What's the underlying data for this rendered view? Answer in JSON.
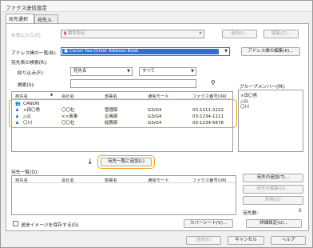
{
  "window": {
    "title": "ファクス送信設定"
  },
  "tabs": [
    {
      "label": "宛先選択",
      "active": true
    },
    {
      "label": "宛先入力",
      "active": false
    }
  ],
  "favorites": {
    "label": "お気に入り(F)",
    "value": "標準設定",
    "add_button": "追加(I)...",
    "edit_button": "編集(Z)..."
  },
  "address_book": {
    "label": "アドレス帳の一覧(B):",
    "value": "Canon Fax Driver Address Book",
    "edit_button": "アドレス帳の編集(K)..."
  },
  "search": {
    "section_label": "宛先表の検索(R):",
    "filter_label": "絞り込み(F):",
    "filter_value": "宛先名",
    "filter_scope": "すべて",
    "keyword_label": "検索(S):",
    "keyword_value": ""
  },
  "group_members": {
    "label": "グループメンバー(M):",
    "items": [
      "×田〇男",
      "△山",
      "〇川"
    ]
  },
  "columns": [
    "宛先名",
    "会社名",
    "部署名",
    "通信モード",
    "ファクス番号/URI"
  ],
  "address_rows": [
    {
      "type": "group",
      "name": "CANON",
      "company": "",
      "dept": "",
      "mode": "",
      "fax": ""
    },
    {
      "type": "person",
      "name": "×田〇男",
      "company": "〇〇社",
      "dept": "管理部",
      "mode": "G3/G4",
      "fax": "03-1111-2222"
    },
    {
      "type": "person",
      "name": "△山",
      "company": "××商事",
      "dept": "企画部",
      "mode": "G3/G4",
      "fax": "03-1234-1111"
    },
    {
      "type": "person",
      "name": "〇川",
      "company": "〇〇社",
      "dept": "総務部",
      "mode": "G3/G4",
      "fax": "03-1234-5678"
    }
  ],
  "add_to_list_button": "宛先一覧に追加(L)",
  "destination_list": {
    "label": "宛先一覧(O):",
    "add_button": "宛先の追加(T)...",
    "edit_button": "宛先の編集(D)...",
    "delete_button": "削除(D)",
    "count_label": "宛先数:",
    "count_value": "0"
  },
  "save_image": {
    "label": "送信イメージを保存する(G)",
    "checked": false
  },
  "cover_sheet_button": "カバーシート(V)...",
  "detail_button": "詳細設定(U)...",
  "footer": {
    "send": "送信(E)",
    "cancel": "キャンセル",
    "help": "ヘルプ"
  }
}
